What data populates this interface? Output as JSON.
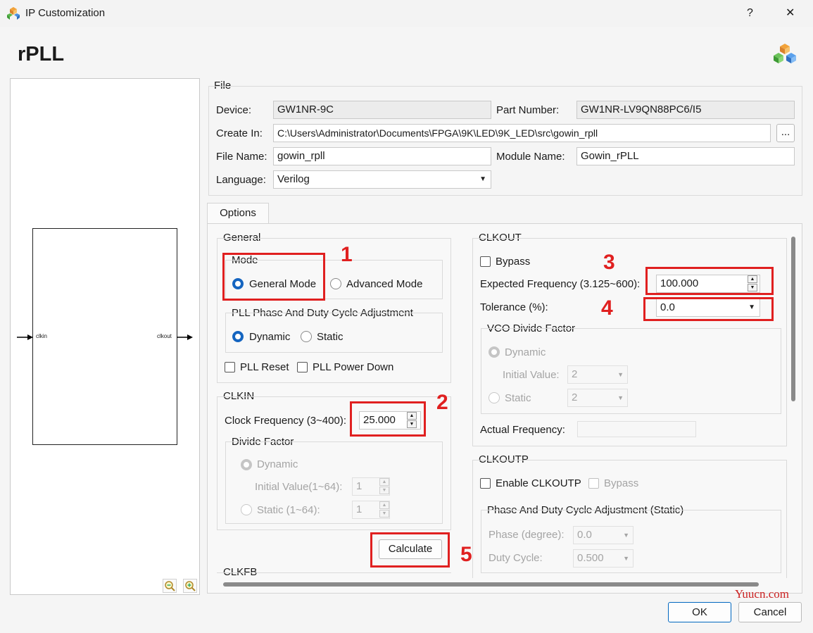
{
  "window": {
    "title": "IP Customization",
    "help_glyph": "?",
    "close_glyph": "✕"
  },
  "header": {
    "ip_name": "rPLL"
  },
  "diagram": {
    "input_port": "clkin",
    "output_port": "clkout"
  },
  "file": {
    "group_label": "File",
    "device_label": "Device:",
    "device_value": "GW1NR-9C",
    "part_number_label": "Part Number:",
    "part_number_value": "GW1NR-LV9QN88PC6/I5",
    "create_in_label": "Create In:",
    "create_in_value": "C:\\Users\\Administrator\\Documents\\FPGA\\9K\\LED\\9K_LED\\src\\gowin_rpll",
    "browse_label": "...",
    "file_name_label": "File Name:",
    "file_name_value": "gowin_rpll",
    "module_name_label": "Module Name:",
    "module_name_value": "Gowin_rPLL",
    "language_label": "Language:",
    "language_value": "Verilog"
  },
  "options_tab": "Options",
  "general": {
    "group_label": "General",
    "mode_label": "Mode",
    "general_mode": "General Mode",
    "advanced_mode": "Advanced Mode",
    "phase_group": "PLL Phase And Duty Cycle Adjustment",
    "dynamic": "Dynamic",
    "static": "Static",
    "pll_reset": "PLL Reset",
    "pll_power_down": "PLL Power Down"
  },
  "clkin": {
    "group_label": "CLKIN",
    "clock_freq_label": "Clock Frequency (3~400):",
    "clock_freq_value": "25.000",
    "divide_group": "Divide Factor",
    "dynamic": "Dynamic",
    "initial_label": "Initial Value(1~64):",
    "initial_value": "1",
    "static_label": "Static (1~64):",
    "static_value": "1"
  },
  "calculate_label": "Calculate",
  "clkfb_label": "CLKFB",
  "clkout": {
    "group_label": "CLKOUT",
    "bypass": "Bypass",
    "expected_label": "Expected Frequency (3.125~600):",
    "expected_value": "100.000",
    "tolerance_label": "Tolerance (%):",
    "tolerance_value": "0.0",
    "vco_group": "VCO Divide Factor",
    "dynamic": "Dynamic",
    "initial_label": "Initial Value:",
    "initial_value": "2",
    "static": "Static",
    "static_value": "2",
    "actual_label": "Actual Frequency:",
    "actual_value": ""
  },
  "clkoutp": {
    "group_label": "CLKOUTP",
    "enable": "Enable CLKOUTP",
    "bypass": "Bypass",
    "phase_group": "Phase And Duty Cycle Adjustment (Static)",
    "phase_label": "Phase (degree):",
    "phase_value": "0.0",
    "duty_label": "Duty Cycle:",
    "duty_value": "0.500"
  },
  "annotations": [
    "1",
    "2",
    "3",
    "4",
    "5"
  ],
  "watermark": "Yuucn.com",
  "footer": {
    "ok_label": "OK",
    "cancel_label": "Cancel"
  },
  "colors": {
    "annotation_red": "#e02020",
    "radio_blue": "#1565c0",
    "watermark_red": "#cc2222"
  }
}
